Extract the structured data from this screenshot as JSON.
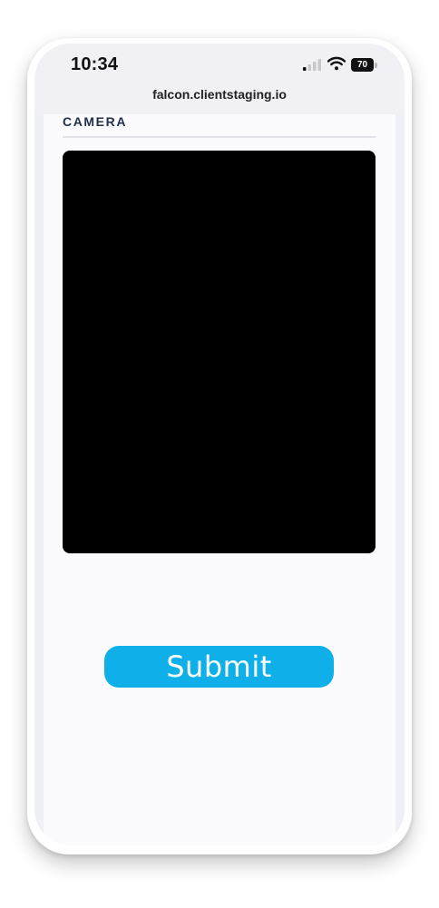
{
  "status_bar": {
    "time": "10:34",
    "battery_level": "70",
    "icons": [
      "cellular-signal-icon",
      "wifi-icon",
      "battery-icon"
    ]
  },
  "browser": {
    "url": "falcon.clientstaging.io"
  },
  "form": {
    "section_title": "CAMERA",
    "submit_label": "Submit"
  },
  "colors": {
    "accent": "#0fb0ea",
    "title": "#22304a",
    "camera_bg": "#000000"
  }
}
